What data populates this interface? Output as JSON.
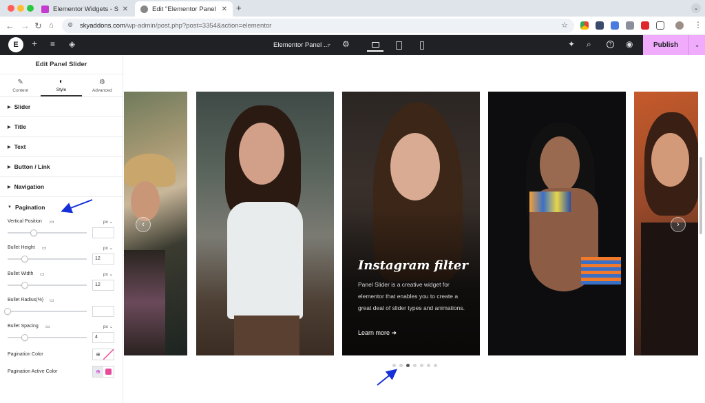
{
  "browser": {
    "tabs": [
      {
        "title": "Elementor Widgets - Sky Add",
        "active": false
      },
      {
        "title": "Edit \"Elementor Panel Slider\" ‹",
        "active": true
      }
    ],
    "new_tab_symbol": "+",
    "url": {
      "host": "skyaddons.com",
      "path": "/wp-admin/post.php?post=3354&action=elementor"
    }
  },
  "elementor_bar": {
    "logo_text": "E",
    "document_name": "Elementor Panel ...",
    "publish_label": "Publish",
    "accent_color": "#f0abfc"
  },
  "panel": {
    "title": "Edit Panel Slider",
    "tabs": [
      {
        "label": "Content",
        "icon": "pencil-icon",
        "active": false
      },
      {
        "label": "Style",
        "icon": "contrast-icon",
        "active": true
      },
      {
        "label": "Advanced",
        "icon": "gear-icon",
        "active": false
      }
    ],
    "sections": [
      "Slider",
      "Title",
      "Text",
      "Button / Link",
      "Navigation"
    ],
    "open_section": "Pagination",
    "controls": [
      {
        "label": "Vertical Position",
        "unit": "px",
        "value": "",
        "level": 0.33
      },
      {
        "label": "Bullet Height",
        "unit": "px",
        "value": "12",
        "level": 0.22
      },
      {
        "label": "Bullet Width",
        "unit": "px",
        "value": "12",
        "level": 0.22
      },
      {
        "label": "Bullet Radius(%)",
        "unit": "",
        "value": "",
        "level": 0.0
      },
      {
        "label": "Bullet Spacing",
        "unit": "px",
        "value": "4",
        "level": 0.22
      }
    ],
    "colors": [
      {
        "label": "Pagination Color",
        "swatch": "none"
      },
      {
        "label": "Pagination Active Color",
        "swatch": "#e94b9b"
      }
    ]
  },
  "slider": {
    "active_slide_title": "Instagram filter",
    "active_slide_text": "Panel Slider is a creative widget for elementor that enables you to create a great deal of slider types and animations.",
    "button_label": "Learn more",
    "pagination_count": 7,
    "active_bullet": 2
  }
}
